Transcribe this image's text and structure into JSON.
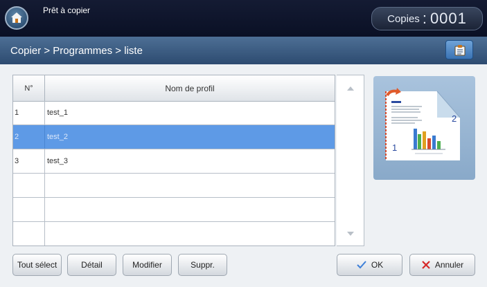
{
  "header": {
    "status": "Prêt à copier",
    "copies_label": "Copies",
    "copies_sep": ":",
    "copies_value": "0001"
  },
  "breadcrumb": {
    "text": "Copier > Programmes > liste"
  },
  "table": {
    "columns": [
      "N°",
      "Nom de profil"
    ],
    "rows": [
      {
        "no": "1",
        "name": "test_1",
        "selected": false
      },
      {
        "no": "2",
        "name": "test_2",
        "selected": true
      },
      {
        "no": "3",
        "name": "test_3",
        "selected": false
      },
      {
        "no": "",
        "name": "",
        "selected": false
      },
      {
        "no": "",
        "name": "",
        "selected": false
      },
      {
        "no": "",
        "name": "",
        "selected": false
      }
    ]
  },
  "buttons": {
    "select_all": "Tout sélect",
    "detail": "Détail",
    "modify": "Modifier",
    "delete": "Suppr.",
    "ok": "OK",
    "cancel": "Annuler"
  },
  "preview": {
    "page_1": "1",
    "page_2": "2"
  },
  "colors": {
    "selected_row": "#5e9ae6",
    "ok_check": "#3d7fd8",
    "cancel_x": "#d62828"
  }
}
